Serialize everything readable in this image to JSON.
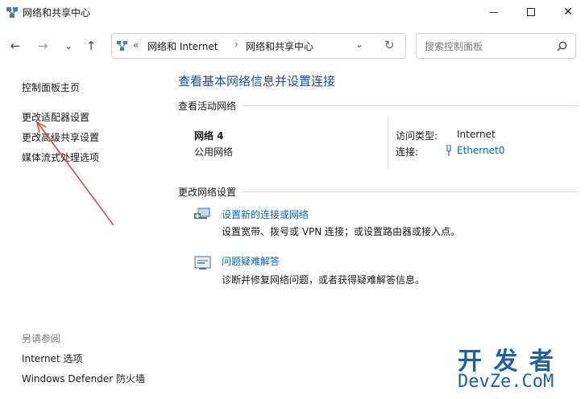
{
  "window": {
    "title": "网络和共享中心",
    "min_glyph": "—",
    "max_glyph": "☐",
    "close_glyph": "✕"
  },
  "nav": {
    "back": "←",
    "forward": "→",
    "history": "⌄",
    "up": "↑"
  },
  "address": {
    "chevrons": "«",
    "crumb1": "网络和 Internet",
    "sep": "›",
    "crumb2": "网络和共享中心",
    "dropdown": "⌄",
    "refresh": "↻"
  },
  "search": {
    "placeholder": "搜索控制面板"
  },
  "sidebar": {
    "home": "控制面板主页",
    "items": [
      "更改适配器设置",
      "更改高级共享设置",
      "媒体流式处理选项"
    ],
    "see_also_title": "另请参阅",
    "see_also": [
      "Internet 选项",
      "Windows Defender 防火墙"
    ]
  },
  "main": {
    "heading": "查看基本网络信息并设置连接",
    "active_networks_title": "查看活动网络",
    "network": {
      "name": "网络 4",
      "type": "公用网络",
      "access_label": "访问类型:",
      "access_value": "Internet",
      "conn_label": "连接:",
      "conn_value": "Ethernet0"
    },
    "change_settings_title": "更改网络设置",
    "tasks": [
      {
        "title": "设置新的连接或网络",
        "desc": "设置宽带、拨号或 VPN 连接；或设置路由器或接入点。"
      },
      {
        "title": "问题疑难解答",
        "desc": "诊断并修复网络问题，或者获得疑难解答信息。"
      }
    ]
  },
  "watermark": {
    "line1": "开 发 者",
    "line2": "DevZe.CoM"
  },
  "colors": {
    "link": "#0066cc",
    "heading": "#1f4e9c",
    "annotation_arrow": "#d9433a"
  }
}
